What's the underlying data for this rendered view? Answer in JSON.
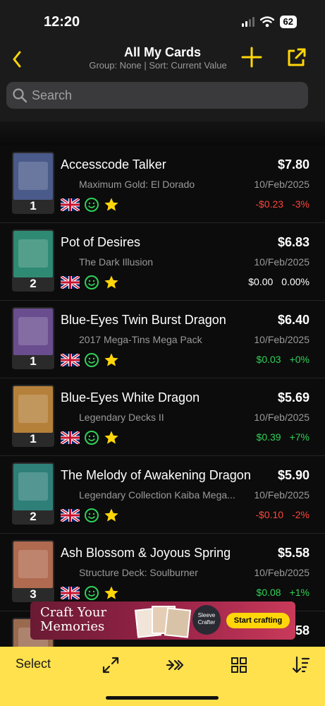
{
  "status": {
    "time": "12:20",
    "battery": "62"
  },
  "nav": {
    "title": "All My Cards",
    "subtitle": "Group: None | Sort: Current Value",
    "back_icon": "chevron-left-icon",
    "add_icon": "plus-icon",
    "share_icon": "share-icon"
  },
  "search": {
    "placeholder": "Search"
  },
  "colors": {
    "accent": "#ffd60a",
    "toolbar": "#ffe14d",
    "negative": "#ff453a",
    "positive": "#30d158"
  },
  "cards": [
    {
      "name": "Accesscode Talker",
      "set": "Maximum Gold: El Dorado",
      "price": "$7.80",
      "date": "10/Feb/2025",
      "change": "-$0.23",
      "change_pct": "-3%",
      "trend": "neg",
      "qty": "1",
      "art_color": "#4a5a8a"
    },
    {
      "name": "Pot of Desires",
      "set": "The Dark Illusion",
      "price": "$6.83",
      "date": "10/Feb/2025",
      "change": "$0.00",
      "change_pct": "0.00%",
      "trend": "zero",
      "qty": "2",
      "art_color": "#2f8a73"
    },
    {
      "name": "Blue-Eyes Twin Burst Dragon",
      "set": "2017 Mega-Tins Mega Pack",
      "price": "$6.40",
      "date": "10/Feb/2025",
      "change": "$0.03",
      "change_pct": "+0%",
      "trend": "pos",
      "qty": "1",
      "art_color": "#6a4d8f"
    },
    {
      "name": "Blue-Eyes White Dragon",
      "set": "Legendary Decks II",
      "price": "$5.69",
      "date": "10/Feb/2025",
      "change": "$0.39",
      "change_pct": "+7%",
      "trend": "pos",
      "qty": "1",
      "art_color": "#b5813a"
    },
    {
      "name": "The Melody of Awakening Dragon",
      "set": "Legendary Collection Kaiba Mega...",
      "price": "$5.90",
      "date": "10/Feb/2025",
      "change": "-$0.10",
      "change_pct": "-2%",
      "trend": "neg",
      "qty": "2",
      "art_color": "#2f7f79"
    },
    {
      "name": "Ash Blossom & Joyous Spring",
      "set": "Structure Deck: Soulburner",
      "price": "$5.58",
      "date": "10/Feb/2025",
      "change": "$0.08",
      "change_pct": "+1%",
      "trend": "pos",
      "qty": "3",
      "art_color": "#b06a4f"
    },
    {
      "name": "",
      "set": "",
      "price": "58",
      "date": "",
      "change": "",
      "change_pct": "",
      "trend": "zero",
      "qty": "",
      "art_color": "#9a6a4f"
    }
  ],
  "ad": {
    "title_line1": "Craft Your",
    "title_line2": "Memories",
    "logo_line1": "Sleeve",
    "logo_line2": "Crafter",
    "cta": "Start crafting"
  },
  "toolbar": {
    "select_label": "Select",
    "icons": [
      "expand-icon",
      "skip-forward-icon",
      "grid-icon",
      "sort-icon"
    ]
  }
}
